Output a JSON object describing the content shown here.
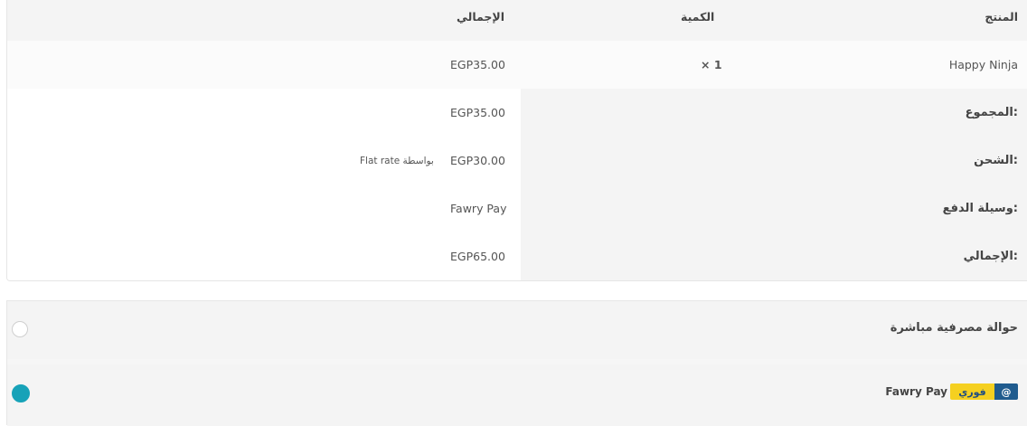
{
  "order_table": {
    "headers": {
      "product": "المنتج",
      "quantity": "الكمية",
      "total": "الإجمالي"
    },
    "item": {
      "name": "Happy Ninja",
      "quantity": "× 1",
      "total": "EGP35.00"
    },
    "subtotal": {
      "label": "المجموع:",
      "value": "EGP35.00"
    },
    "shipping": {
      "label": "الشحن:",
      "value": "EGP30.00",
      "method": "بواسطة Flat rate"
    },
    "payment_method": {
      "label": "وسيلة الدفع:",
      "value": "Fawry Pay"
    },
    "grand_total": {
      "label": "الإجمالي:",
      "value": "EGP65.00"
    }
  },
  "payment_options": {
    "bank_transfer": {
      "label": "حوالة مصرفية مباشرة",
      "selected": false
    },
    "fawry": {
      "label": "Fawry Pay",
      "selected": true,
      "logo_at": "@",
      "logo_word": "فوري"
    }
  },
  "colors": {
    "accent": "#17a2b8",
    "fawry_yellow": "#f5d020",
    "fawry_blue": "#1f5b8e"
  }
}
